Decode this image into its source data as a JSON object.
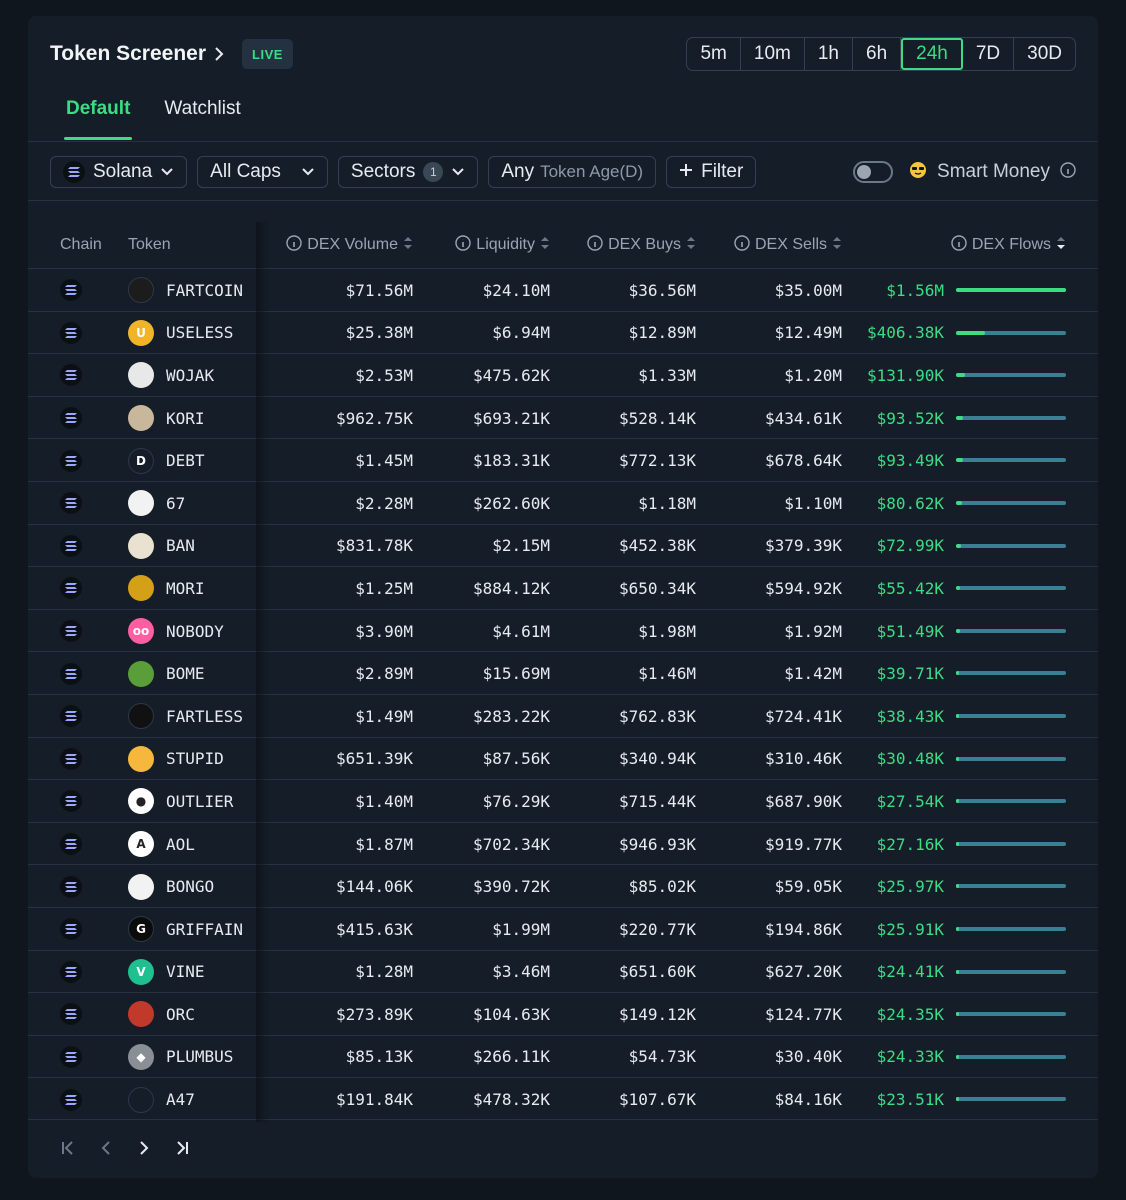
{
  "header": {
    "title": "Token Screener",
    "live_label": "LIVE"
  },
  "time_tabs": [
    "5m",
    "10m",
    "1h",
    "6h",
    "24h",
    "7D",
    "30D"
  ],
  "active_time_tab": "24h",
  "view_tabs": [
    "Default",
    "Watchlist"
  ],
  "active_view_tab": "Default",
  "filters": {
    "chain": "Solana",
    "caps": "All Caps",
    "sectors": "Sectors",
    "sectors_count": "1",
    "age_prefix": "Any",
    "age_label": "Token Age(D)",
    "add_filter": "Filter"
  },
  "smart_money": {
    "label": "Smart Money",
    "enabled": false
  },
  "columns": {
    "chain": "Chain",
    "token": "Token",
    "dex_volume": "DEX Volume",
    "liquidity": "Liquidity",
    "dex_buys": "DEX Buys",
    "dex_sells": "DEX Sells",
    "dex_flows": "DEX Flows"
  },
  "rows": [
    {
      "token": "FARTCOIN",
      "icon": "fartcoin-icon",
      "icon_color": "#1c1c1c",
      "icon_text": "",
      "dex_volume": "$71.56M",
      "liquidity": "$24.10M",
      "dex_buys": "$36.56M",
      "dex_sells": "$35.00M",
      "dex_flows": "$1.56M",
      "flow_ratio": 1.0
    },
    {
      "token": "USELESS",
      "icon": "useless-icon",
      "icon_color": "#f0b429",
      "icon_text": "U",
      "dex_volume": "$25.38M",
      "liquidity": "$6.94M",
      "dex_buys": "$12.89M",
      "dex_sells": "$12.49M",
      "dex_flows": "$406.38K",
      "flow_ratio": 0.26
    },
    {
      "token": "WOJAK",
      "icon": "wojak-icon",
      "icon_color": "#e8e8e8",
      "icon_text": "",
      "dex_volume": "$2.53M",
      "liquidity": "$475.62K",
      "dex_buys": "$1.33M",
      "dex_sells": "$1.20M",
      "dex_flows": "$131.90K",
      "flow_ratio": 0.085
    },
    {
      "token": "KORI",
      "icon": "kori-icon",
      "icon_color": "#c9b79c",
      "icon_text": "",
      "dex_volume": "$962.75K",
      "liquidity": "$693.21K",
      "dex_buys": "$528.14K",
      "dex_sells": "$434.61K",
      "dex_flows": "$93.52K",
      "flow_ratio": 0.06
    },
    {
      "token": "DEBT",
      "icon": "debt-icon",
      "icon_color": "#151e28",
      "icon_text": "D",
      "dex_volume": "$1.45M",
      "liquidity": "$183.31K",
      "dex_buys": "$772.13K",
      "dex_sells": "$678.64K",
      "dex_flows": "$93.49K",
      "flow_ratio": 0.06
    },
    {
      "token": "67",
      "icon": "67-icon",
      "icon_color": "#f2f2f2",
      "icon_text": "",
      "dex_volume": "$2.28M",
      "liquidity": "$262.60K",
      "dex_buys": "$1.18M",
      "dex_sells": "$1.10M",
      "dex_flows": "$80.62K",
      "flow_ratio": 0.052
    },
    {
      "token": "BAN",
      "icon": "ban-icon",
      "icon_color": "#e9e2d0",
      "icon_text": "",
      "dex_volume": "$831.78K",
      "liquidity": "$2.15M",
      "dex_buys": "$452.38K",
      "dex_sells": "$379.39K",
      "dex_flows": "$72.99K",
      "flow_ratio": 0.047
    },
    {
      "token": "MORI",
      "icon": "mori-icon",
      "icon_color": "#d4a017",
      "icon_text": "",
      "dex_volume": "$1.25M",
      "liquidity": "$884.12K",
      "dex_buys": "$650.34K",
      "dex_sells": "$594.92K",
      "dex_flows": "$55.42K",
      "flow_ratio": 0.036
    },
    {
      "token": "NOBODY",
      "icon": "nobody-icon",
      "icon_color": "#ff5fa2",
      "icon_text": "oo",
      "dex_volume": "$3.90M",
      "liquidity": "$4.61M",
      "dex_buys": "$1.98M",
      "dex_sells": "$1.92M",
      "dex_flows": "$51.49K",
      "flow_ratio": 0.033
    },
    {
      "token": "BOME",
      "icon": "bome-icon",
      "icon_color": "#5a9e3a",
      "icon_text": "",
      "dex_volume": "$2.89M",
      "liquidity": "$15.69M",
      "dex_buys": "$1.46M",
      "dex_sells": "$1.42M",
      "dex_flows": "$39.71K",
      "flow_ratio": 0.025
    },
    {
      "token": "FARTLESS",
      "icon": "fartless-icon",
      "icon_color": "#111111",
      "icon_text": "",
      "dex_volume": "$1.49M",
      "liquidity": "$283.22K",
      "dex_buys": "$762.83K",
      "dex_sells": "$724.41K",
      "dex_flows": "$38.43K",
      "flow_ratio": 0.025
    },
    {
      "token": "STUPID",
      "icon": "stupid-icon",
      "icon_color": "#f5b83d",
      "icon_text": "",
      "dex_volume": "$651.39K",
      "liquidity": "$87.56K",
      "dex_buys": "$340.94K",
      "dex_sells": "$310.46K",
      "dex_flows": "$30.48K",
      "flow_ratio": 0.02
    },
    {
      "token": "OUTLIER",
      "icon": "outlier-icon",
      "icon_color": "#ffffff",
      "icon_text": "●",
      "dex_volume": "$1.40M",
      "liquidity": "$76.29K",
      "dex_buys": "$715.44K",
      "dex_sells": "$687.90K",
      "dex_flows": "$27.54K",
      "flow_ratio": 0.018
    },
    {
      "token": "AOL",
      "icon": "aol-icon",
      "icon_color": "#ffffff",
      "icon_text": "A",
      "dex_volume": "$1.87M",
      "liquidity": "$702.34K",
      "dex_buys": "$946.93K",
      "dex_sells": "$919.77K",
      "dex_flows": "$27.16K",
      "flow_ratio": 0.017
    },
    {
      "token": "BONGO",
      "icon": "bongo-icon",
      "icon_color": "#f2f2f2",
      "icon_text": "",
      "dex_volume": "$144.06K",
      "liquidity": "$390.72K",
      "dex_buys": "$85.02K",
      "dex_sells": "$59.05K",
      "dex_flows": "$25.97K",
      "flow_ratio": 0.017
    },
    {
      "token": "GRIFFAIN",
      "icon": "griffain-icon",
      "icon_color": "#0b0b0b",
      "icon_text": "G",
      "dex_volume": "$415.63K",
      "liquidity": "$1.99M",
      "dex_buys": "$220.77K",
      "dex_sells": "$194.86K",
      "dex_flows": "$25.91K",
      "flow_ratio": 0.017
    },
    {
      "token": "VINE",
      "icon": "vine-icon",
      "icon_color": "#1fbf8f",
      "icon_text": "V",
      "dex_volume": "$1.28M",
      "liquidity": "$3.46M",
      "dex_buys": "$651.60K",
      "dex_sells": "$627.20K",
      "dex_flows": "$24.41K",
      "flow_ratio": 0.016
    },
    {
      "token": "ORC",
      "icon": "orc-icon",
      "icon_color": "#c0392b",
      "icon_text": "",
      "dex_volume": "$273.89K",
      "liquidity": "$104.63K",
      "dex_buys": "$149.12K",
      "dex_sells": "$124.77K",
      "dex_flows": "$24.35K",
      "flow_ratio": 0.016
    },
    {
      "token": "PLUMBUS",
      "icon": "plumbus-icon",
      "icon_color": "#8a8f96",
      "icon_text": "◆",
      "dex_volume": "$85.13K",
      "liquidity": "$266.11K",
      "dex_buys": "$54.73K",
      "dex_sells": "$30.40K",
      "dex_flows": "$24.33K",
      "flow_ratio": 0.016
    },
    {
      "token": "A47",
      "icon": "a47-icon",
      "icon_color": "#151e28",
      "icon_text": "",
      "dex_volume": "$191.84K",
      "liquidity": "$478.32K",
      "dex_buys": "$107.67K",
      "dex_sells": "$84.16K",
      "dex_flows": "$23.51K",
      "flow_ratio": 0.015
    }
  ],
  "colors": {
    "accent": "#3ddc84",
    "background": "#151e28",
    "bar_track": "#3b7f94"
  }
}
